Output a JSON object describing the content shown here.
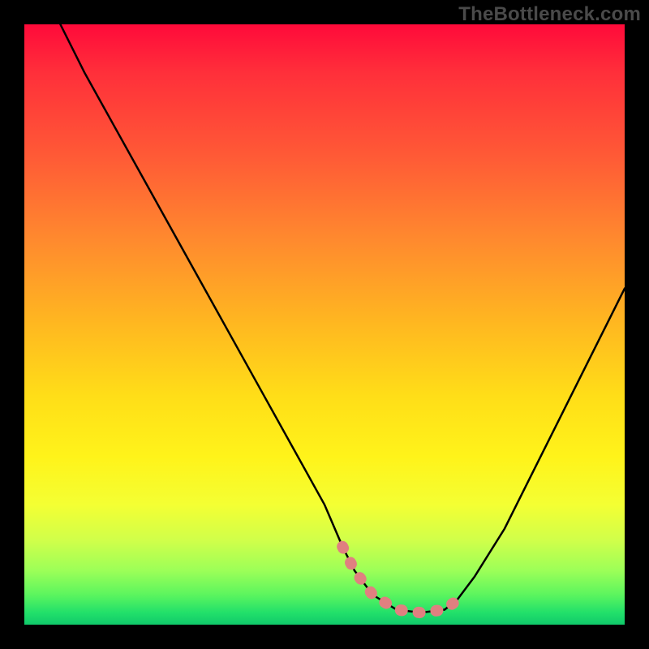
{
  "watermark": "TheBottleneck.com",
  "colors": {
    "page_bg": "#000000",
    "curve_stroke": "#000000",
    "highlight_stroke": "#e08080",
    "watermark_text": "#4a4a4a"
  },
  "chart_data": {
    "type": "line",
    "title": "",
    "xlabel": "",
    "ylabel": "",
    "xlim": [
      0,
      100
    ],
    "ylim": [
      0,
      100
    ],
    "series": [
      {
        "name": "bottleneck-curve",
        "x": [
          6,
          10,
          15,
          20,
          25,
          30,
          35,
          40,
          45,
          50,
          53,
          55,
          58,
          62,
          66,
          70,
          72,
          75,
          80,
          85,
          90,
          95,
          100
        ],
        "y": [
          100,
          92,
          83,
          74,
          65,
          56,
          47,
          38,
          29,
          20,
          13,
          9,
          5,
          2.5,
          2,
          2.5,
          4,
          8,
          16,
          26,
          36,
          46,
          56
        ]
      }
    ],
    "highlight_segment": {
      "name": "optimal-range",
      "x": [
        53,
        55,
        58,
        62,
        66,
        70,
        72
      ],
      "y": [
        13,
        9,
        5,
        2.5,
        2,
        2.5,
        4
      ]
    }
  }
}
